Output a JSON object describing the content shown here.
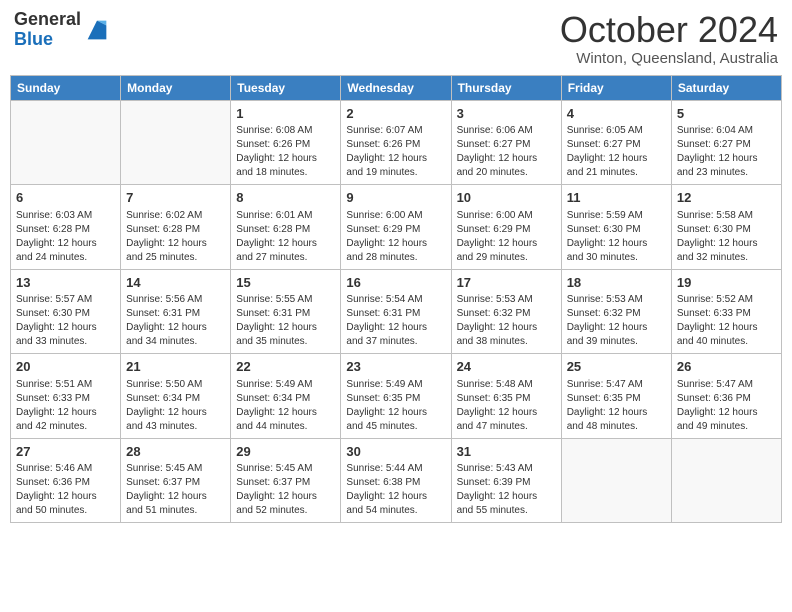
{
  "header": {
    "logo_general": "General",
    "logo_blue": "Blue",
    "month_title": "October 2024",
    "location": "Winton, Queensland, Australia"
  },
  "days_of_week": [
    "Sunday",
    "Monday",
    "Tuesday",
    "Wednesday",
    "Thursday",
    "Friday",
    "Saturday"
  ],
  "weeks": [
    [
      {
        "day": null,
        "info": null
      },
      {
        "day": null,
        "info": null
      },
      {
        "day": "1",
        "info": "Sunrise: 6:08 AM\nSunset: 6:26 PM\nDaylight: 12 hours and 18 minutes."
      },
      {
        "day": "2",
        "info": "Sunrise: 6:07 AM\nSunset: 6:26 PM\nDaylight: 12 hours and 19 minutes."
      },
      {
        "day": "3",
        "info": "Sunrise: 6:06 AM\nSunset: 6:27 PM\nDaylight: 12 hours and 20 minutes."
      },
      {
        "day": "4",
        "info": "Sunrise: 6:05 AM\nSunset: 6:27 PM\nDaylight: 12 hours and 21 minutes."
      },
      {
        "day": "5",
        "info": "Sunrise: 6:04 AM\nSunset: 6:27 PM\nDaylight: 12 hours and 23 minutes."
      }
    ],
    [
      {
        "day": "6",
        "info": "Sunrise: 6:03 AM\nSunset: 6:28 PM\nDaylight: 12 hours and 24 minutes."
      },
      {
        "day": "7",
        "info": "Sunrise: 6:02 AM\nSunset: 6:28 PM\nDaylight: 12 hours and 25 minutes."
      },
      {
        "day": "8",
        "info": "Sunrise: 6:01 AM\nSunset: 6:28 PM\nDaylight: 12 hours and 27 minutes."
      },
      {
        "day": "9",
        "info": "Sunrise: 6:00 AM\nSunset: 6:29 PM\nDaylight: 12 hours and 28 minutes."
      },
      {
        "day": "10",
        "info": "Sunrise: 6:00 AM\nSunset: 6:29 PM\nDaylight: 12 hours and 29 minutes."
      },
      {
        "day": "11",
        "info": "Sunrise: 5:59 AM\nSunset: 6:30 PM\nDaylight: 12 hours and 30 minutes."
      },
      {
        "day": "12",
        "info": "Sunrise: 5:58 AM\nSunset: 6:30 PM\nDaylight: 12 hours and 32 minutes."
      }
    ],
    [
      {
        "day": "13",
        "info": "Sunrise: 5:57 AM\nSunset: 6:30 PM\nDaylight: 12 hours and 33 minutes."
      },
      {
        "day": "14",
        "info": "Sunrise: 5:56 AM\nSunset: 6:31 PM\nDaylight: 12 hours and 34 minutes."
      },
      {
        "day": "15",
        "info": "Sunrise: 5:55 AM\nSunset: 6:31 PM\nDaylight: 12 hours and 35 minutes."
      },
      {
        "day": "16",
        "info": "Sunrise: 5:54 AM\nSunset: 6:31 PM\nDaylight: 12 hours and 37 minutes."
      },
      {
        "day": "17",
        "info": "Sunrise: 5:53 AM\nSunset: 6:32 PM\nDaylight: 12 hours and 38 minutes."
      },
      {
        "day": "18",
        "info": "Sunrise: 5:53 AM\nSunset: 6:32 PM\nDaylight: 12 hours and 39 minutes."
      },
      {
        "day": "19",
        "info": "Sunrise: 5:52 AM\nSunset: 6:33 PM\nDaylight: 12 hours and 40 minutes."
      }
    ],
    [
      {
        "day": "20",
        "info": "Sunrise: 5:51 AM\nSunset: 6:33 PM\nDaylight: 12 hours and 42 minutes."
      },
      {
        "day": "21",
        "info": "Sunrise: 5:50 AM\nSunset: 6:34 PM\nDaylight: 12 hours and 43 minutes."
      },
      {
        "day": "22",
        "info": "Sunrise: 5:49 AM\nSunset: 6:34 PM\nDaylight: 12 hours and 44 minutes."
      },
      {
        "day": "23",
        "info": "Sunrise: 5:49 AM\nSunset: 6:35 PM\nDaylight: 12 hours and 45 minutes."
      },
      {
        "day": "24",
        "info": "Sunrise: 5:48 AM\nSunset: 6:35 PM\nDaylight: 12 hours and 47 minutes."
      },
      {
        "day": "25",
        "info": "Sunrise: 5:47 AM\nSunset: 6:35 PM\nDaylight: 12 hours and 48 minutes."
      },
      {
        "day": "26",
        "info": "Sunrise: 5:47 AM\nSunset: 6:36 PM\nDaylight: 12 hours and 49 minutes."
      }
    ],
    [
      {
        "day": "27",
        "info": "Sunrise: 5:46 AM\nSunset: 6:36 PM\nDaylight: 12 hours and 50 minutes."
      },
      {
        "day": "28",
        "info": "Sunrise: 5:45 AM\nSunset: 6:37 PM\nDaylight: 12 hours and 51 minutes."
      },
      {
        "day": "29",
        "info": "Sunrise: 5:45 AM\nSunset: 6:37 PM\nDaylight: 12 hours and 52 minutes."
      },
      {
        "day": "30",
        "info": "Sunrise: 5:44 AM\nSunset: 6:38 PM\nDaylight: 12 hours and 54 minutes."
      },
      {
        "day": "31",
        "info": "Sunrise: 5:43 AM\nSunset: 6:39 PM\nDaylight: 12 hours and 55 minutes."
      },
      {
        "day": null,
        "info": null
      },
      {
        "day": null,
        "info": null
      }
    ]
  ]
}
